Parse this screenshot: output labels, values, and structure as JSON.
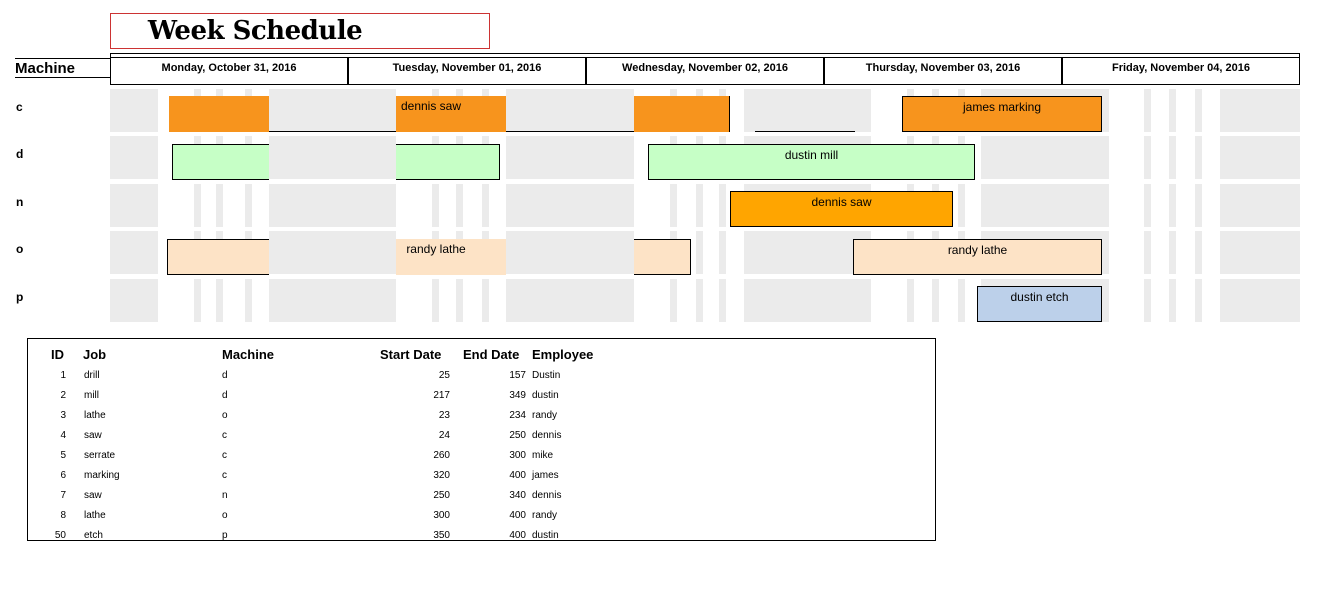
{
  "title": "Week Schedule",
  "machine_header": "Machine",
  "days": [
    "Monday, October 31, 2016",
    "Tuesday, November 01, 2016",
    "Wednesday, November 02, 2016",
    "Thursday, November 03, 2016",
    "Friday, November 04, 2016"
  ],
  "rows": [
    {
      "machine": "c"
    },
    {
      "machine": "d"
    },
    {
      "machine": "n"
    },
    {
      "machine": "o"
    },
    {
      "machine": "p"
    }
  ],
  "tasks": {
    "c_dennis_saw": "dennis saw",
    "c_james_marking": "james marking",
    "d_dustin_mill": "dustin mill",
    "n_dennis_saw": "dennis saw",
    "o_randy_lathe_1": "randy lathe",
    "o_randy_lathe_2": "randy lathe",
    "p_dustin_etch": "dustin etch"
  },
  "colors": {
    "orange": "#f7941d",
    "orange_dark": "#ffa500",
    "green": "#c6ffc6",
    "peach": "#fde3c6",
    "blue": "#bcd0ea",
    "stripe": "#ebebeb",
    "title_border": "#cc3333"
  },
  "table": {
    "headers": {
      "id": "ID",
      "job": "Job",
      "machine": "Machine",
      "start": "Start Date",
      "end": "End Date",
      "employee": "Employee"
    },
    "rows": [
      {
        "id": "1",
        "job": "drill",
        "machine": "d",
        "start": "25",
        "end": "157",
        "employee": "Dustin"
      },
      {
        "id": "2",
        "job": "mill",
        "machine": "d",
        "start": "217",
        "end": "349",
        "employee": "dustin"
      },
      {
        "id": "3",
        "job": "lathe",
        "machine": "o",
        "start": "23",
        "end": "234",
        "employee": "randy"
      },
      {
        "id": "4",
        "job": "saw",
        "machine": "c",
        "start": "24",
        "end": "250",
        "employee": "dennis"
      },
      {
        "id": "5",
        "job": "serrate",
        "machine": "c",
        "start": "260",
        "end": "300",
        "employee": "mike"
      },
      {
        "id": "6",
        "job": "marking",
        "machine": "c",
        "start": "320",
        "end": "400",
        "employee": "james"
      },
      {
        "id": "7",
        "job": "saw",
        "machine": "n",
        "start": "250",
        "end": "340",
        "employee": "dennis"
      },
      {
        "id": "8",
        "job": "lathe",
        "machine": "o",
        "start": "300",
        "end": "400",
        "employee": "randy"
      },
      {
        "id": "50",
        "job": "etch",
        "machine": "p",
        "start": "350",
        "end": "400",
        "employee": "dustin"
      }
    ]
  }
}
